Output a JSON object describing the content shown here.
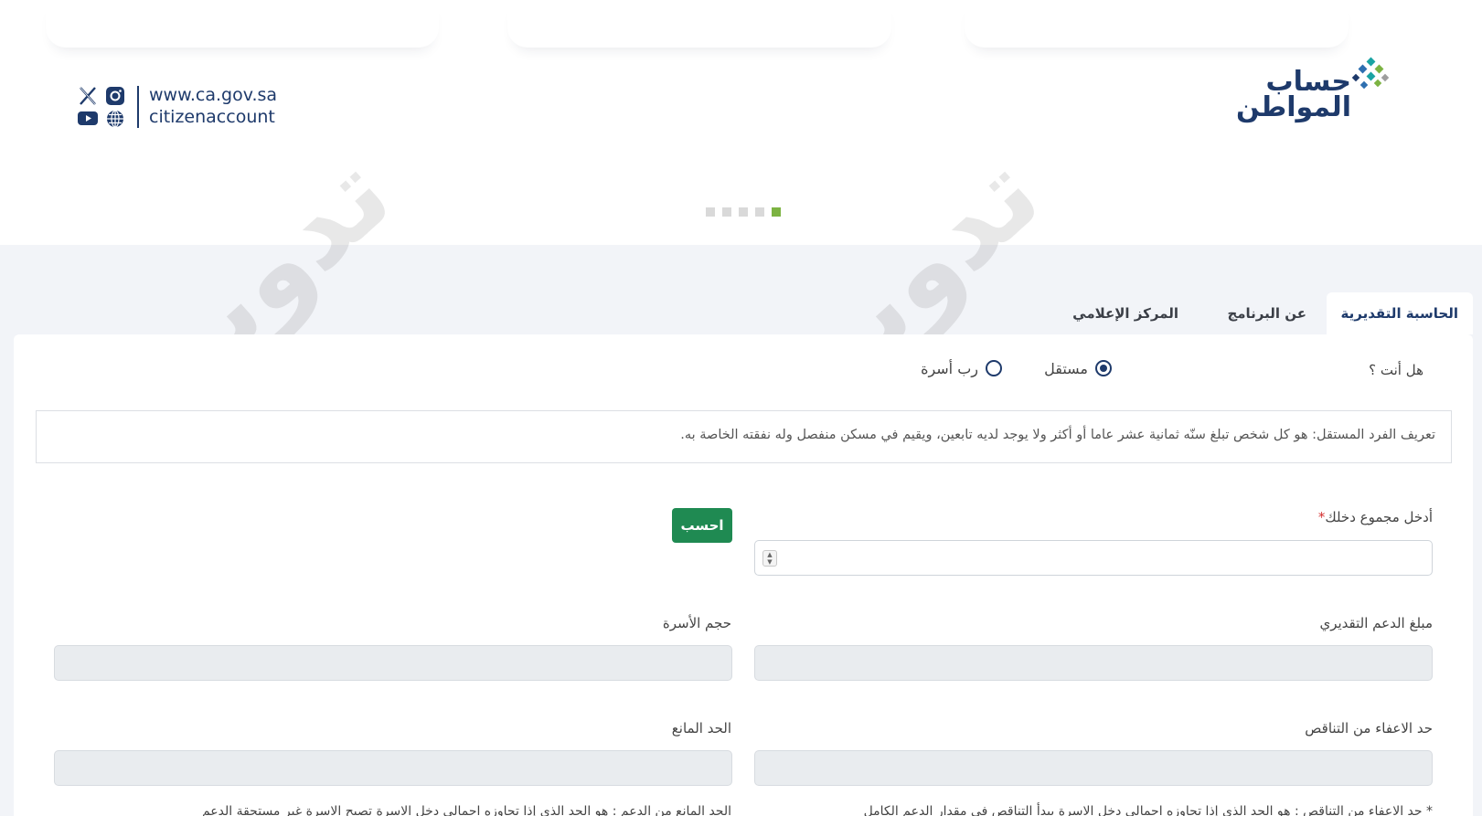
{
  "header": {
    "logo_line1": "حساب",
    "logo_line2": "المواطن",
    "website": "www.ca.gov.sa",
    "handle": "citizenaccount",
    "social_icons": [
      "x-icon",
      "instagram-icon",
      "youtube-icon",
      "globe-icon"
    ],
    "brand_color": "#1e3a6b",
    "slider_dots": 5,
    "active_dot": 5
  },
  "tabs": [
    {
      "label": "الحاسبة التقديرية",
      "active": true
    },
    {
      "label": "عن البرنامج",
      "active": false
    },
    {
      "label": "المركز الإعلامي",
      "active": false
    }
  ],
  "form": {
    "question": "هل أنت ؟",
    "options": [
      {
        "label": "مستقل",
        "selected": true
      },
      {
        "label": "رب أسرة",
        "selected": false
      }
    ],
    "definition": "تعريف الفرد المستقل: هو كل شخص تبلغ سنّه ثمانية عشر عاما أو أكثر ولا يوجد لديه تابعين، ويقيم في مسكن منفصل وله نفقته الخاصة به.",
    "income_label": "أدخل مجموع دخلك",
    "income_required_mark": "*",
    "income_value": "",
    "calculate_button": "احسب",
    "support_label": "مبلغ الدعم التقديري",
    "family_size_label": "حجم الأسرة",
    "exemption_label": "حد الاعفاء من التناقص",
    "limit_label": "الحد المانع",
    "note_right": "* حد الاعفاء من التناقص : هو الحد الذي إذا تجاوزه اجمالي دخل الاسرة يبدأ التناقص  في مقدار الدعم الكامل",
    "note_left": "الحد المانع من الدعم : هو الحد الذي إذا تجاوزه اجمالي دخل الاسرة تصبح الاسرة غير مستحقة الدعم"
  },
  "colors": {
    "button_green": "#1f8a52",
    "active_dot": "#7cb342",
    "required": "#d32f2f"
  }
}
